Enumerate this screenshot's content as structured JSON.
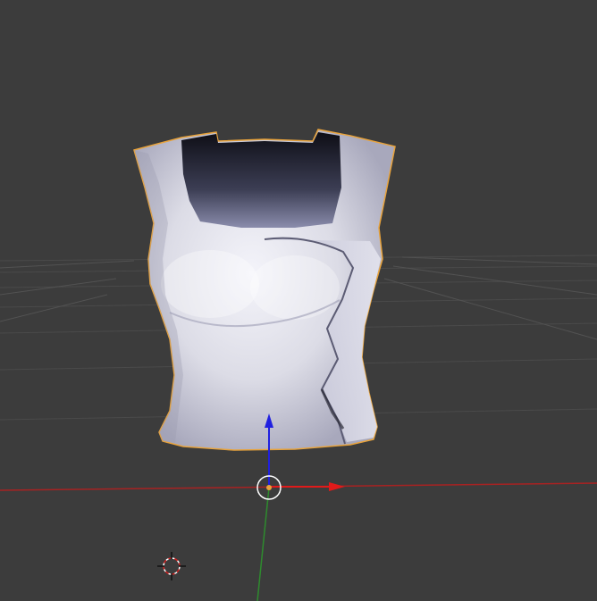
{
  "viewport": {
    "background": "#3c3c3c",
    "grid_color": "#4d4d4d",
    "x_axis_color": "#b02020",
    "y_axis_color": "#2e8b2e"
  },
  "object": {
    "kind": "shirt-mesh",
    "selected": true,
    "selection_outline_color": "#e8a33c"
  },
  "gizmo": {
    "x_arrow_color": "#e01a1a",
    "z_arrow_color": "#2020e0"
  },
  "icons": {
    "cursor": "3d-cursor-icon",
    "pivot": "object-origin-icon"
  }
}
